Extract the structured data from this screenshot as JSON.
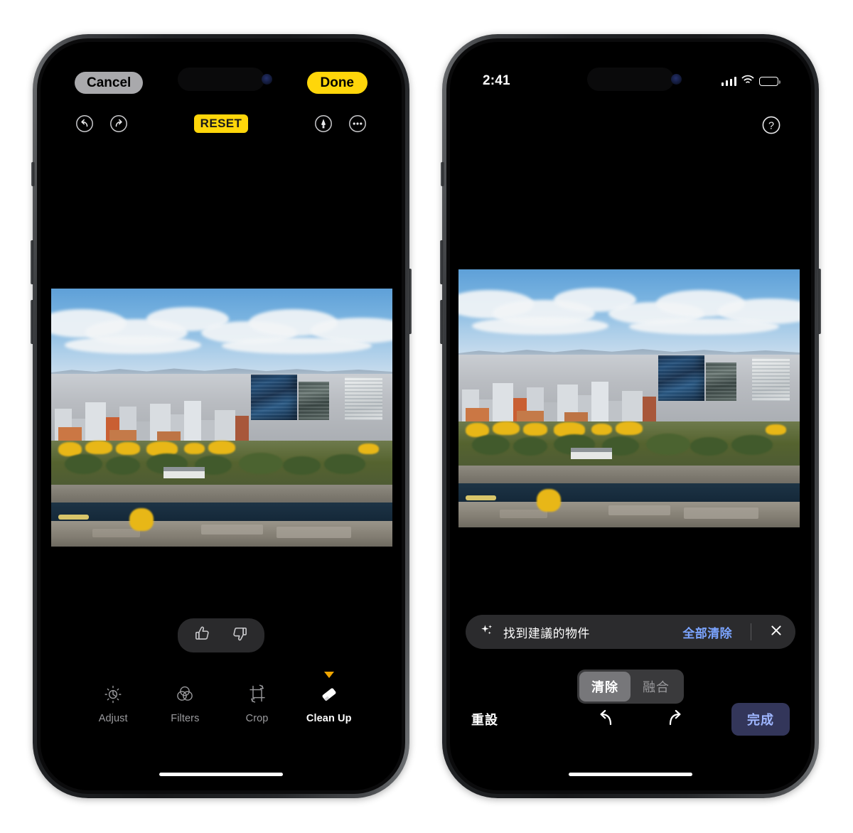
{
  "scene": {
    "description": "Two iPhone screenshots side by side showing Photos app Clean Up editing tool",
    "frame_color": "#2b2d30",
    "accent_yellow": "#ffd60a",
    "accent_blue": "#7ba4ff"
  },
  "left_phone": {
    "top_bar": {
      "cancel_label": "Cancel",
      "done_label": "Done"
    },
    "edit_bar": {
      "undo_icon": "undo-icon",
      "redo_icon": "redo-icon",
      "reset_label": "RESET",
      "markup_icon": "markup-pen-icon",
      "more_icon": "more-options-icon"
    },
    "feedback": {
      "thumbs_up_icon": "thumbs-up-icon",
      "thumbs_down_icon": "thumbs-down-icon"
    },
    "tools": [
      {
        "label": "Adjust",
        "icon": "adjust-icon",
        "active": false,
        "badge": false
      },
      {
        "label": "Filters",
        "icon": "filters-icon",
        "active": false,
        "badge": false
      },
      {
        "label": "Crop",
        "icon": "crop-icon",
        "active": false,
        "badge": false
      },
      {
        "label": "Clean Up",
        "icon": "eraser-icon",
        "active": true,
        "badge": true
      }
    ],
    "photo": {
      "alt": "Aerial view of Osaka city skyline with Osaka Castle park, autumn ginkgo trees and moat"
    }
  },
  "right_phone": {
    "status_bar": {
      "time": "2:41",
      "signal_icon": "cellular-signal-icon",
      "wifi_icon": "wifi-icon",
      "battery_icon": "battery-icon"
    },
    "help_icon": "help-question-icon",
    "suggestion_bar": {
      "sparkle_icon": "sparkles-icon",
      "text": "找到建議的物件",
      "action_label": "全部清除",
      "close_icon": "close-icon"
    },
    "segmented_control": {
      "options": [
        {
          "label": "清除",
          "selected": true
        },
        {
          "label": "融合",
          "selected": false
        }
      ]
    },
    "bottom_bar": {
      "reset_label": "重設",
      "undo_icon": "undo-icon",
      "redo_icon": "redo-icon",
      "done_label": "完成"
    },
    "photo": {
      "alt": "Aerial view of Osaka city skyline with Osaka Castle park, autumn ginkgo trees and moat"
    }
  }
}
